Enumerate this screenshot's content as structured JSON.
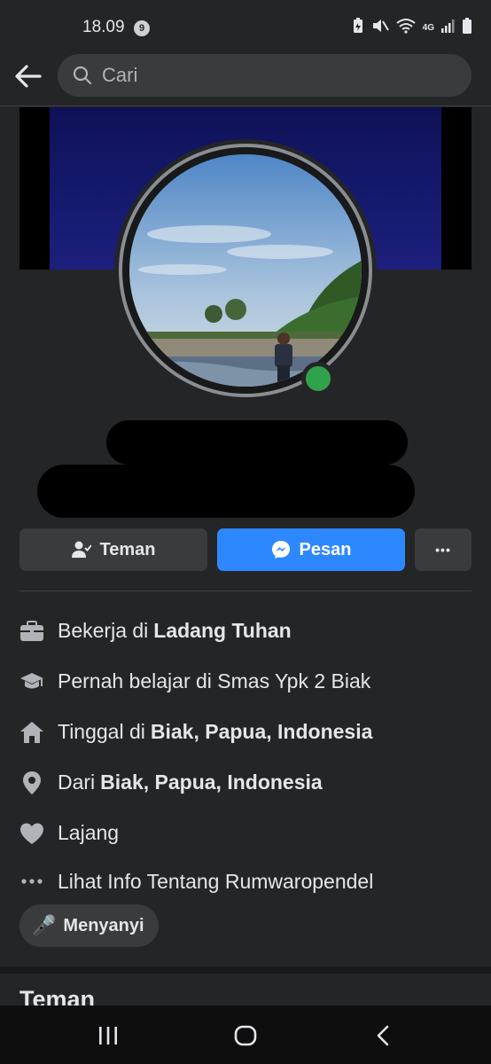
{
  "status_bar": {
    "time": "18.09",
    "notification_count": "9",
    "network": "4G"
  },
  "search": {
    "placeholder": "Cari"
  },
  "actions": {
    "friend_label": "Teman",
    "message_label": "Pesan",
    "more_label": "•••"
  },
  "info": {
    "work_prefix": "Bekerja di",
    "work_value": "Ladang Tuhan",
    "education": "Pernah belajar di Smas Ypk 2 Biak",
    "lives_prefix": "Tinggal di",
    "lives_value": "Biak, Papua, Indonesia",
    "from_prefix": "Dari",
    "from_value": "Biak, Papua, Indonesia",
    "relationship": "Lajang",
    "see_about": "Lihat Info Tentang Rumwaropendel"
  },
  "hobby": {
    "emoji": "🎤",
    "label": "Menyanyi"
  },
  "friends_section": {
    "title": "Teman"
  },
  "colors": {
    "background": "#242526",
    "accent": "#2d88ff",
    "online": "#31a24c",
    "button_secondary": "#3a3b3c"
  },
  "icons": [
    "back-arrow-icon",
    "search-icon",
    "add-friend-icon",
    "messenger-icon",
    "briefcase-icon",
    "graduation-cap-icon",
    "home-icon",
    "location-pin-icon",
    "heart-icon",
    "more-dots-icon",
    "microphone-icon"
  ]
}
